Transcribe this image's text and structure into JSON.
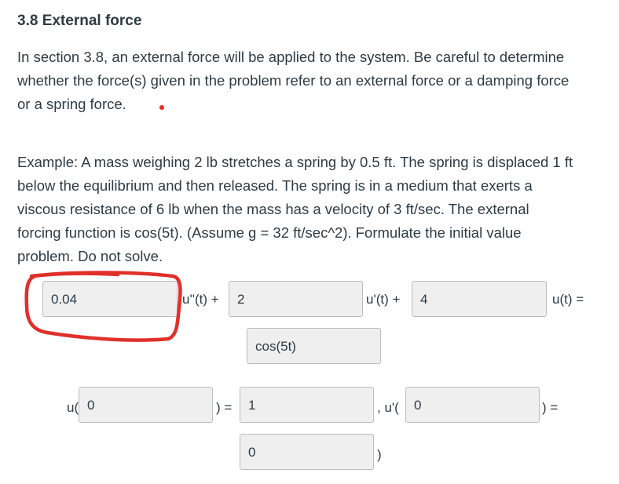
{
  "heading": "3.8 External force",
  "intro_lines": [
    "In section 3.8, an external force will be applied to the system.  Be careful to determine",
    "whether the force(s) given in the problem refer to an external force or a damping force",
    "or a spring force."
  ],
  "example_lines": [
    "Example: A mass weighing 2 lb stretches a spring by 0.5 ft. The spring is displaced 1 ft",
    "below the equilibrium and then released. The spring is in a medium that exerts a",
    "viscous resistance of 6 lb when the mass has a velocity of 3 ft/sec. The external",
    "forcing function is cos(5t). (Assume g = 32 ft/sec^2). Formulate the initial value",
    "problem. Do not solve."
  ],
  "equation": {
    "coef_mass": "0.04",
    "label_u_dd": "u''(t) +",
    "coef_damping": "2",
    "label_u_d": "u'(t) +",
    "coef_spring": "4",
    "label_u_eq": "u(t) =",
    "forcing": "cos(5t)"
  },
  "initial_conditions": {
    "label_u_open": "u(",
    "u_arg": "0",
    "label_close_eq_1": ") =",
    "u_value": "1",
    "label_comma_up": ",  u'(",
    "up_arg": "0",
    "label_close_eq_2": ") =",
    "up_value": "0",
    "label_close_paren": ")"
  },
  "colors": {
    "annotation_red": "#e0302a",
    "input_bg": "#efefef",
    "text": "#2d3b45"
  }
}
